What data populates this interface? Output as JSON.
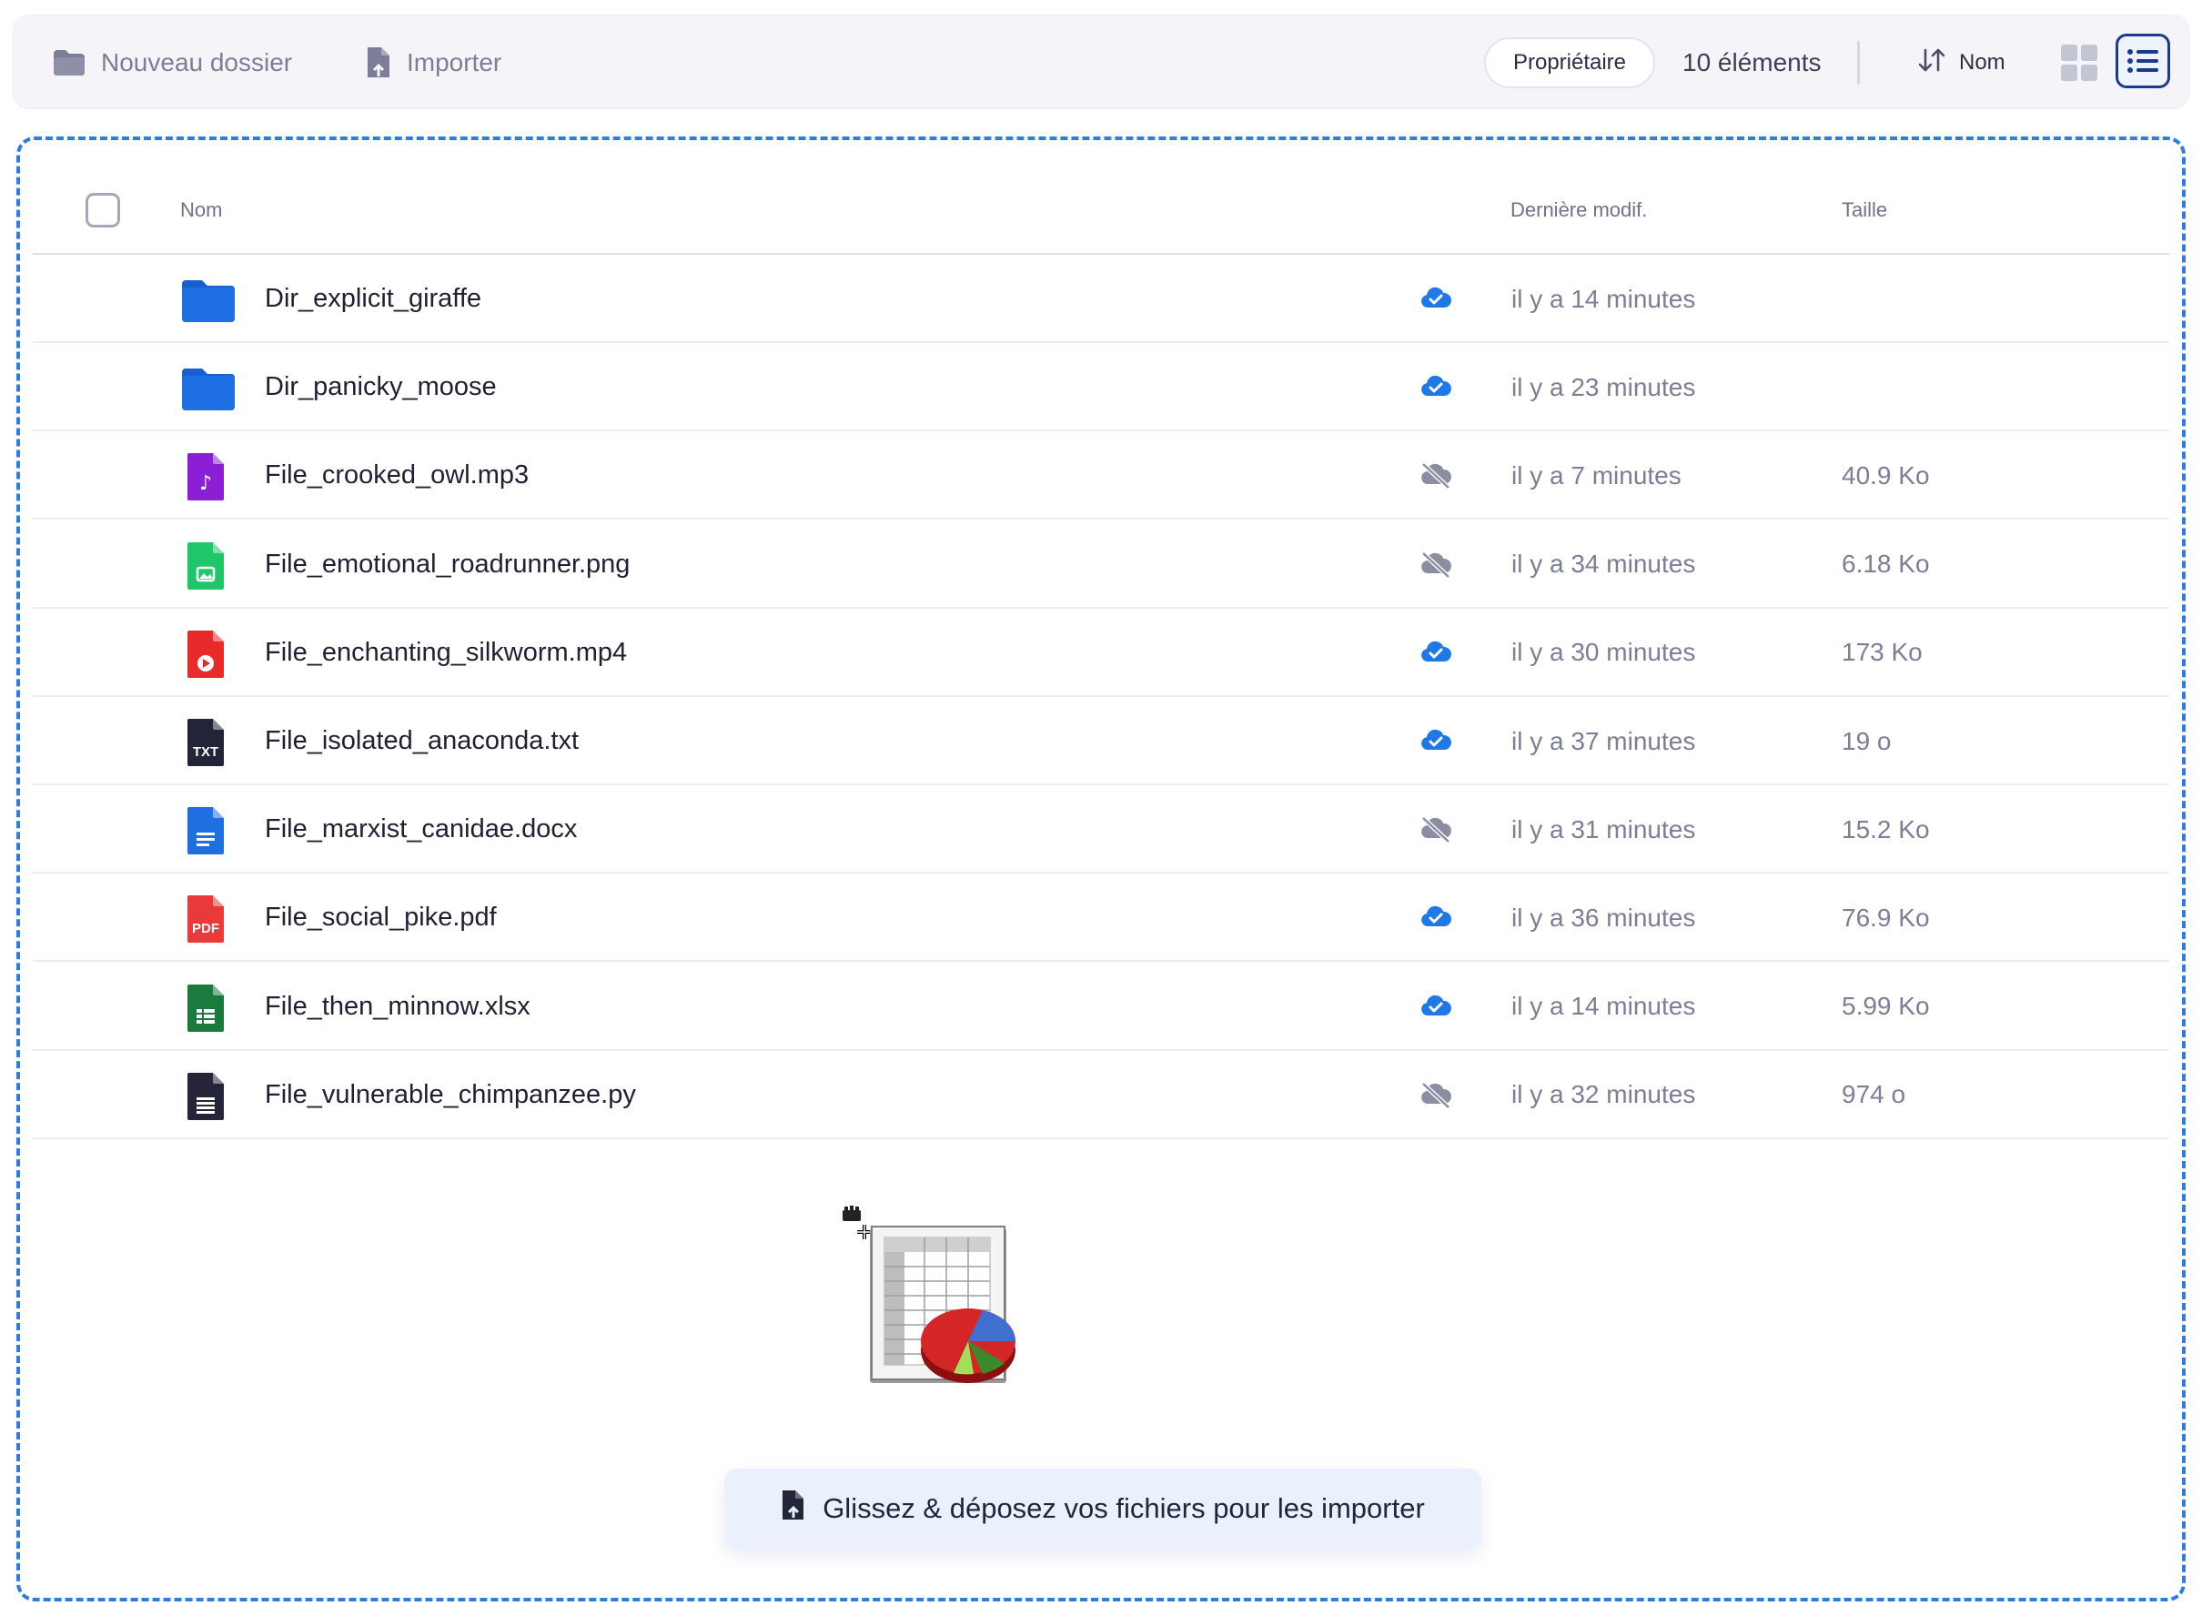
{
  "toolbar": {
    "new_folder_label": "Nouveau dossier",
    "import_label": "Importer",
    "owner_filter_label": "Propriétaire",
    "item_count_label": "10 éléments",
    "sort_label": "Nom",
    "view_mode": "list"
  },
  "table": {
    "headers": {
      "name": "Nom",
      "modified": "Dernière modif.",
      "size": "Taille"
    },
    "rows": [
      {
        "name": "Dir_explicit_giraffe",
        "type_icon": "folder-icon",
        "sync_icon": "cloud-synced-icon",
        "modified": "il y a 14 minutes",
        "size": ""
      },
      {
        "name": "Dir_panicky_moose",
        "type_icon": "folder-icon",
        "sync_icon": "cloud-synced-icon",
        "modified": "il y a 23 minutes",
        "size": ""
      },
      {
        "name": "File_crooked_owl.mp3",
        "type_icon": "audio-file-icon",
        "sync_icon": "cloud-offline-icon",
        "modified": "il y a 7 minutes",
        "size": "40.9 Ko"
      },
      {
        "name": "File_emotional_roadrunner.png",
        "type_icon": "image-file-icon",
        "sync_icon": "cloud-offline-icon",
        "modified": "il y a 34 minutes",
        "size": "6.18 Ko"
      },
      {
        "name": "File_enchanting_silkworm.mp4",
        "type_icon": "video-file-icon",
        "sync_icon": "cloud-synced-icon",
        "modified": "il y a 30 minutes",
        "size": "173 Ko"
      },
      {
        "name": "File_isolated_anaconda.txt",
        "type_icon": "text-file-icon",
        "sync_icon": "cloud-synced-icon",
        "modified": "il y a 37 minutes",
        "size": "19 o"
      },
      {
        "name": "File_marxist_canidae.docx",
        "type_icon": "document-file-icon",
        "sync_icon": "cloud-offline-icon",
        "modified": "il y a 31 minutes",
        "size": "15.2 Ko"
      },
      {
        "name": "File_social_pike.pdf",
        "type_icon": "pdf-file-icon",
        "sync_icon": "cloud-synced-icon",
        "modified": "il y a 36 minutes",
        "size": "76.9 Ko"
      },
      {
        "name": "File_then_minnow.xlsx",
        "type_icon": "spreadsheet-file-icon",
        "sync_icon": "cloud-synced-icon",
        "modified": "il y a 14 minutes",
        "size": "5.99 Ko"
      },
      {
        "name": "File_vulnerable_chimpanzee.py",
        "type_icon": "code-file-icon",
        "sync_icon": "cloud-offline-icon",
        "modified": "il y a 32 minutes",
        "size": "974 o"
      }
    ]
  },
  "icon_labels": {
    "txt": "TXT",
    "pdf": "PDF"
  },
  "dropzone": {
    "hint_label": "Glissez & déposez vos fichiers pour les importer"
  },
  "colors": {
    "accent": "#2f7be0",
    "folder": "#1f6fe5",
    "audio": "#8a1fd6",
    "image": "#1fc76a",
    "video": "#e82a2a",
    "text": "#242438",
    "document": "#1e6fe0",
    "pdf": "#e83a3a",
    "spreadsheet": "#1b7a3e",
    "code": "#262438",
    "cloud_synced": "#1f78e8",
    "cloud_offline": "#8b8ea3"
  }
}
